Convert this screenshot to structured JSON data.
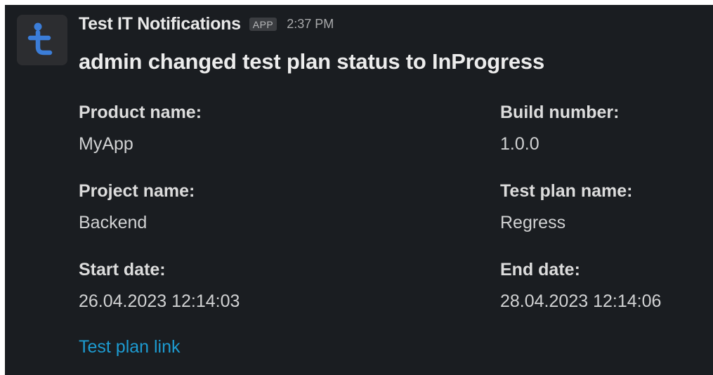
{
  "message": {
    "sender": "Test IT Notifications",
    "badge": "APP",
    "time": "2:37 PM",
    "title": "admin changed test plan status to InProgress",
    "fields": {
      "product_name": {
        "label": "Product name:",
        "value": "MyApp"
      },
      "build_number": {
        "label": "Build number:",
        "value": "1.0.0"
      },
      "project_name": {
        "label": "Project name:",
        "value": "Backend"
      },
      "test_plan_name": {
        "label": "Test plan name:",
        "value": "Regress"
      },
      "start_date": {
        "label": "Start date:",
        "value": "26.04.2023 12:14:03"
      },
      "end_date": {
        "label": "End date:",
        "value": "28.04.2023 12:14:06"
      }
    },
    "link_label": "Test plan link"
  },
  "colors": {
    "background": "#1a1d21",
    "brand_blue": "#3b7dd8",
    "link": "#1d9bd1"
  },
  "icons": {
    "avatar": "test-it-logo-icon"
  }
}
